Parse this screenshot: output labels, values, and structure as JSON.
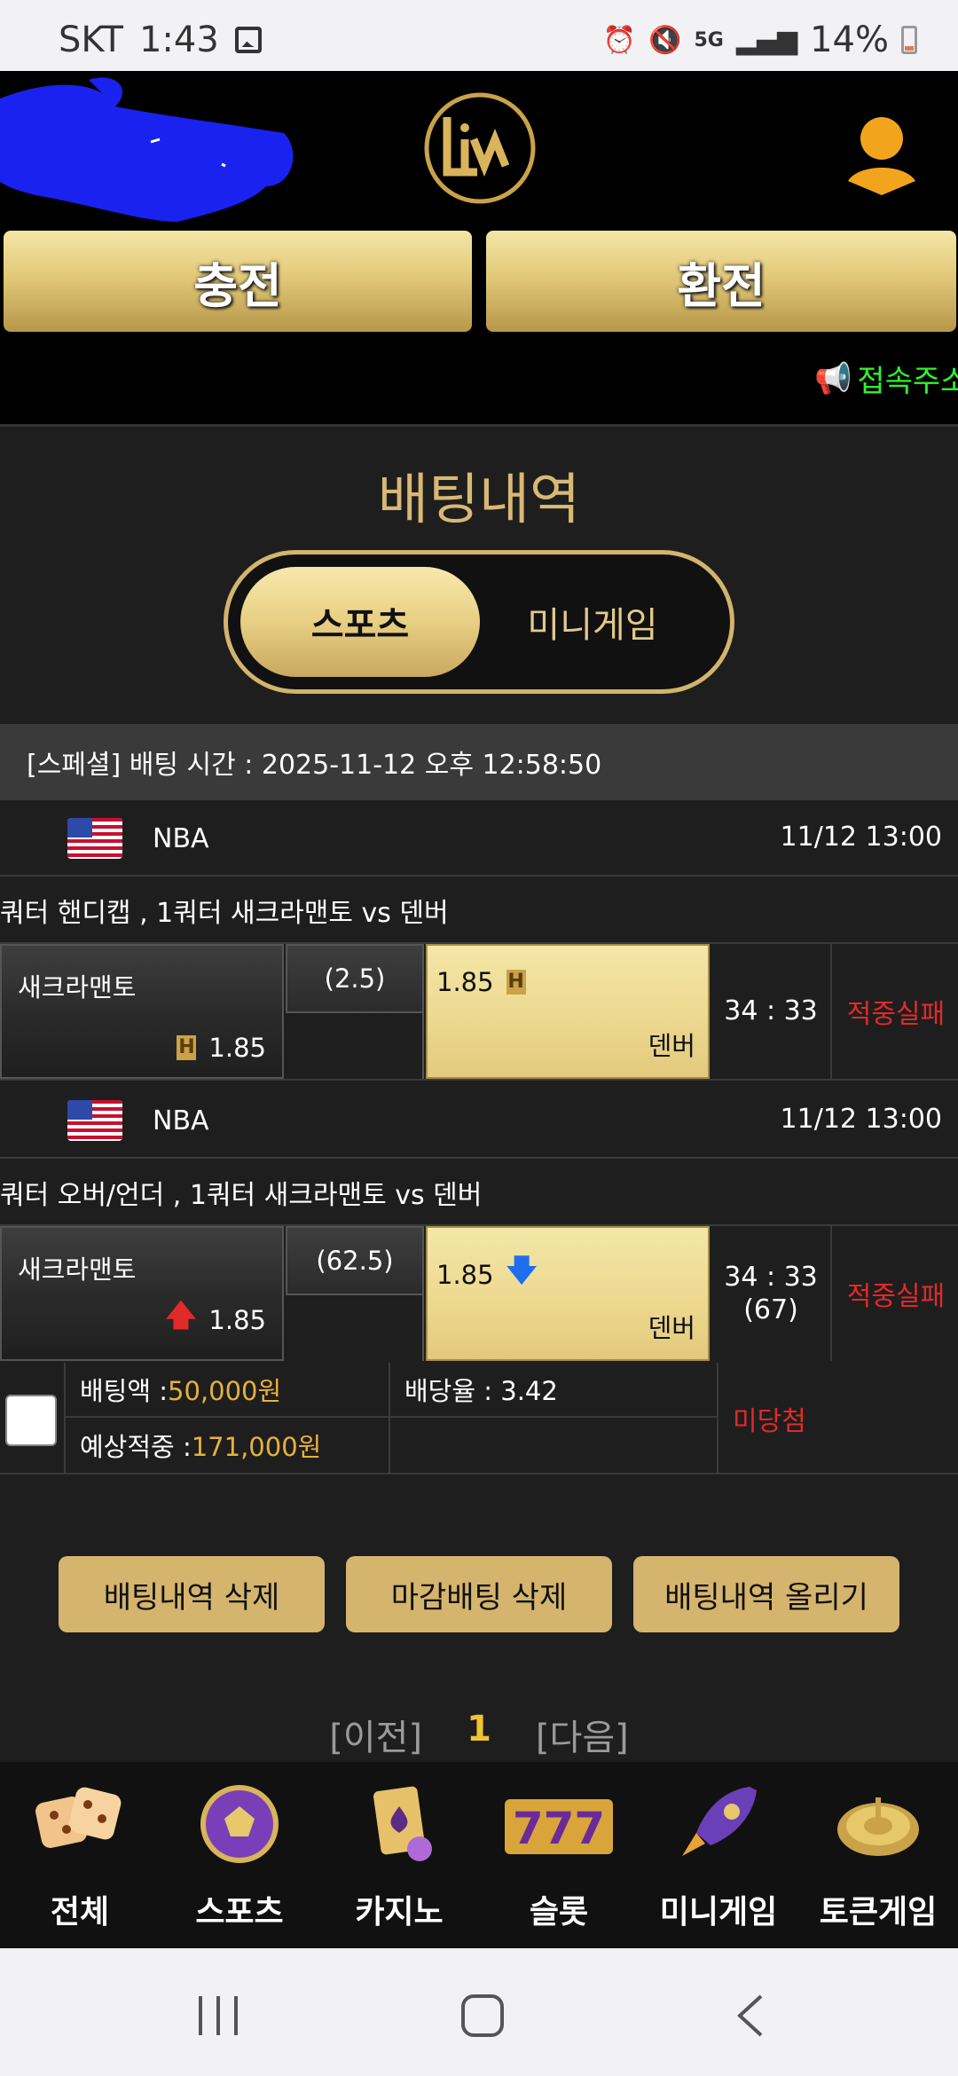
{
  "status_bar": {
    "carrier": "SKT",
    "time": "1:43",
    "network": "5G",
    "battery": "14%"
  },
  "header": {
    "charge_label": "충전",
    "exchange_label": "환전",
    "notice": "접속주소"
  },
  "page": {
    "title": "배팅내역",
    "tabs": [
      {
        "label": "스포츠",
        "active": true
      },
      {
        "label": "미니게임",
        "active": false
      }
    ]
  },
  "bet_slip": {
    "header": "[스페셜] 배팅 시간 : 2025-11-12 오후 12:58:50",
    "items": [
      {
        "league": "NBA",
        "datetime": "11/12 13:00",
        "match": "쿼터 핸디캡 , 1쿼터 새크라맨토  vs  덴버",
        "home_team": "새크라맨토",
        "home_odds": "1.85",
        "line": "(2.5)",
        "away_odds": "1.85",
        "away_team": "덴버",
        "score": "34 : 33",
        "score_sub": "",
        "result": "적중실패"
      },
      {
        "league": "NBA",
        "datetime": "11/12 13:00",
        "match": "쿼터 오버/언더 , 1쿼터 새크라맨토  vs  덴버",
        "home_team": "새크라맨토",
        "home_odds": "1.85",
        "line": "(62.5)",
        "away_odds": "1.85",
        "away_team": "덴버",
        "score": "34 : 33",
        "score_sub": "(67)",
        "result": "적중실패"
      }
    ],
    "summary": {
      "stake_label": "배팅액 : ",
      "stake_value": "50,000원",
      "odds_label": "배당율 : 3.42",
      "expected_label": "예상적중 : ",
      "expected_value": "171,000원",
      "status": "미당첨"
    }
  },
  "actions": {
    "delete_history": "배팅내역 삭제",
    "delete_closed": "마감배팅 삭제",
    "upload_history": "배팅내역 올리기"
  },
  "pagination": {
    "prev": "[이전]",
    "current": "1",
    "next": "[다음]"
  },
  "bottom_nav": [
    {
      "label": "전체",
      "icon": "dice-icon"
    },
    {
      "label": "스포츠",
      "icon": "soccer-ball-icon"
    },
    {
      "label": "카지노",
      "icon": "cards-icon"
    },
    {
      "label": "슬롯",
      "icon": "slot-777-icon"
    },
    {
      "label": "미니게임",
      "icon": "rocket-icon"
    },
    {
      "label": "토큰게임",
      "icon": "roulette-icon"
    }
  ],
  "colors": {
    "gold": "#d5b46d",
    "loss_red": "#e12a2a",
    "notice_green": "#2ef22e",
    "amount_yellow": "#e8b13c"
  }
}
